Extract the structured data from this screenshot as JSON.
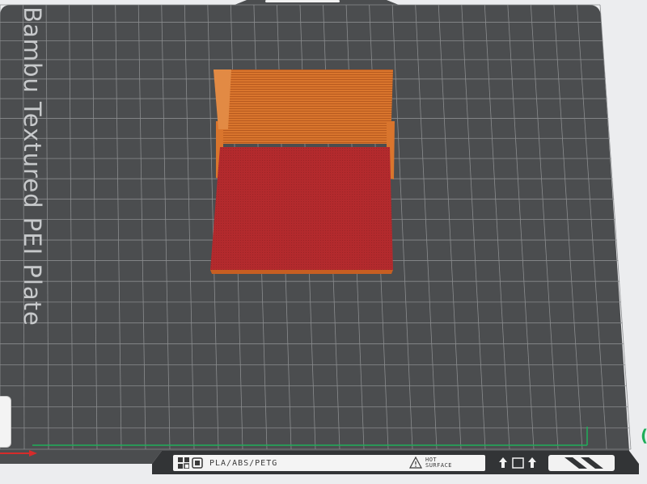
{
  "plate": {
    "name": "Bambu Textured PEI Plate",
    "materials": "PLA/ABS/PETG",
    "warning": {
      "line1": "HOT",
      "line2": "SURFACE"
    }
  },
  "axes": {
    "y_partial_label": "("
  },
  "colors": {
    "background": "#ecedef",
    "plate_surface": "#4b4d4f",
    "grid": "#8a8c8e",
    "model_body": "#d9752d",
    "model_overhang": "#b32a2d",
    "x_axis": "#d62b2b",
    "y_axis": "#1fae5a"
  },
  "icons": [
    "plate-logo-icon",
    "plate-badge-icon",
    "warning-icon",
    "cooling-icons",
    "side-panel-tab"
  ]
}
